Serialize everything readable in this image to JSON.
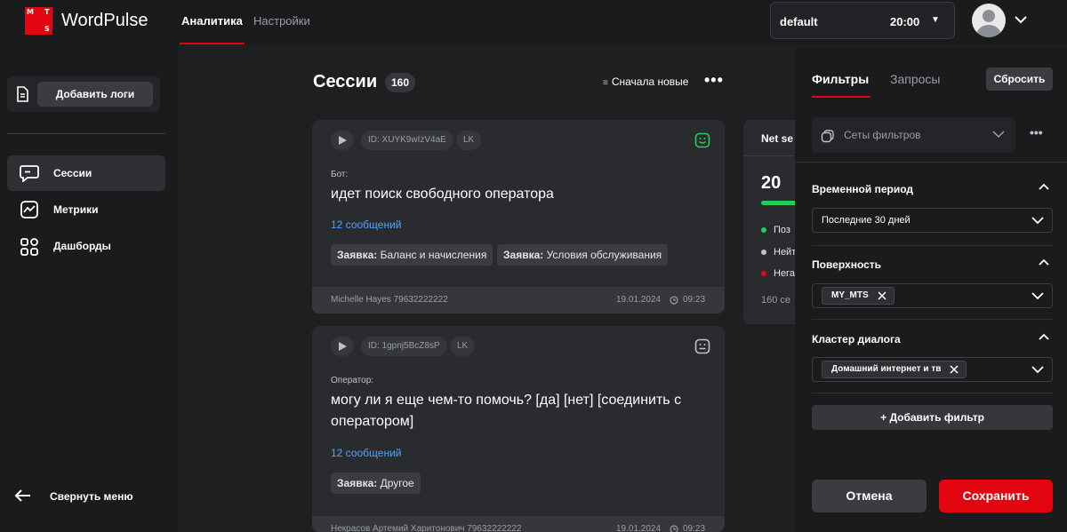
{
  "app": {
    "logo_letters": [
      "M",
      "T",
      "S"
    ],
    "brand": "WordPulse",
    "nav": [
      {
        "label": "Аналитика",
        "active": true
      },
      {
        "label": "Настройки",
        "active": false
      }
    ],
    "project_select": {
      "name": "default",
      "time": "20:00"
    }
  },
  "sidebar": {
    "add_logs_label": "Добавить логи",
    "items": [
      {
        "label": "Сессии",
        "icon": "chat-icon",
        "active": true
      },
      {
        "label": "Метрики",
        "icon": "chart-icon",
        "active": false
      },
      {
        "label": "Дашборды",
        "icon": "dashboard-icon",
        "active": false
      }
    ],
    "collapse_label": "Свернуть меню"
  },
  "main": {
    "title": "Сессии",
    "count": "160",
    "sort_label": "Сначала новые",
    "sessions": [
      {
        "id": "ID: XUYK9wIzV4aE",
        "channel": "LK",
        "sentiment": "positive",
        "role": "Бот:",
        "message": "идет поиск свободного оператора",
        "messages_link": "12 сообщений",
        "tags": [
          {
            "key": "Заявка:",
            "value": "Баланс и начисления"
          },
          {
            "key": "Заявка:",
            "value": "Условия обслуживания"
          }
        ],
        "author": "Michelle Hayes 79632222222",
        "date": "19.01.2024",
        "time": "09:23"
      },
      {
        "id": "ID: 1gpnj5BcZ8sP",
        "channel": "LK",
        "sentiment": "neutral",
        "role": "Оператор:",
        "message": "могу ли я еще чем-то помочь? [да] [нет] [соединить с оператором]",
        "messages_link": "12 сообщений",
        "tags": [
          {
            "key": "Заявка:",
            "value": "Другое"
          }
        ],
        "author": "Некрасов Артемий Харитонович 79632222222",
        "date": "19.01.2024",
        "time": "09:23"
      }
    ],
    "stat_card": {
      "title": "Net se",
      "value": "20",
      "legend": [
        {
          "label": "Поз",
          "color": "#26cd58"
        },
        {
          "label": "Нейт",
          "color": "#bfc2c8"
        },
        {
          "label": "Нега",
          "color": "#e30611"
        }
      ],
      "footer": "160 се"
    }
  },
  "filter_panel": {
    "tabs": [
      {
        "label": "Фильтры",
        "active": true
      },
      {
        "label": "Запросы",
        "active": false
      }
    ],
    "reset_label": "Сбросить",
    "filter_sets_placeholder": "Сеты фильтров",
    "sections": [
      {
        "title": "Временной период",
        "value": "Последние 30 дней"
      },
      {
        "title": "Поверхность",
        "tag": "MY_MTS"
      },
      {
        "title": "Кластер диалога",
        "tag": "Домашний интернет и тв"
      }
    ],
    "add_filter_label": "Добавить фильтр",
    "cancel_label": "Отмена",
    "save_label": "Сохранить"
  },
  "colors": {
    "accent": "#e30611",
    "positive": "#26cd58",
    "link": "#4da3ff",
    "background": "#1e1f21"
  }
}
